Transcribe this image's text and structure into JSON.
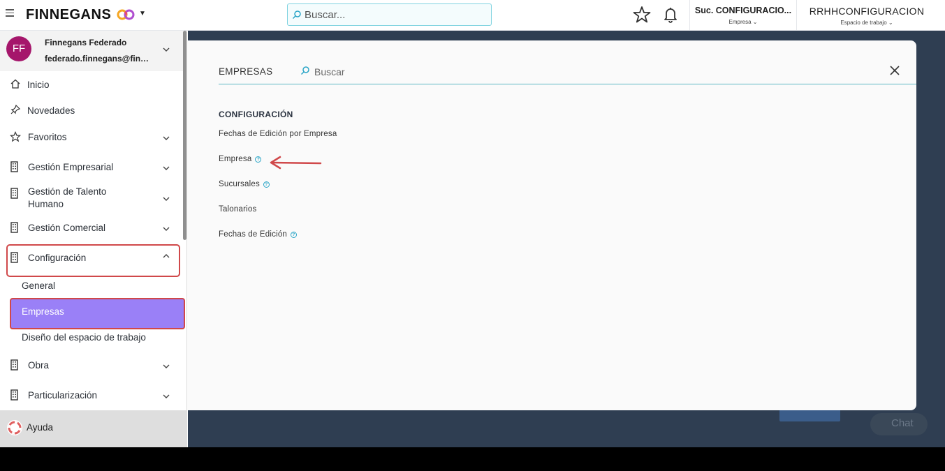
{
  "topbar": {
    "brand": "FINNEGANS",
    "search_placeholder": "Buscar...",
    "branch_value": "Suc. CONFIGURACIO...",
    "branch_label": "Empresa",
    "workspace_value": "RRHHCONFIGURACION",
    "workspace_label": "Espacio de trabajo"
  },
  "user": {
    "initials": "FF",
    "name": "Finnegans Federado",
    "email": "federado.finnegans@finnegans.com.ar"
  },
  "sidebar": {
    "items": [
      {
        "label": "Inicio",
        "icon": "home-icon"
      },
      {
        "label": "Novedades",
        "icon": "pin-icon"
      },
      {
        "label": "Favoritos",
        "icon": "star-icon"
      },
      {
        "label": "Gestión Empresarial",
        "icon": "building-icon"
      },
      {
        "label": "Gestión de Talento Humano",
        "icon": "building-icon"
      },
      {
        "label": "Gestión Comercial",
        "icon": "building-icon"
      },
      {
        "label": "Configuración",
        "icon": "building-icon"
      },
      {
        "label": "Obra",
        "icon": "building-icon"
      },
      {
        "label": "Particularización",
        "icon": "building-icon"
      }
    ],
    "config_subitems": [
      "General",
      "Empresas",
      "Diseño del espacio de trabajo"
    ],
    "help_label": "Ayuda"
  },
  "modal": {
    "title": "EMPRESAS",
    "search_placeholder": "Buscar",
    "section_title": "CONFIGURACIÓN",
    "links": [
      {
        "label": "Fechas de Edición por Empresa",
        "help": false
      },
      {
        "label": "Empresa",
        "help": true
      },
      {
        "label": "Sucursales",
        "help": true
      },
      {
        "label": "Talonarios",
        "help": false
      },
      {
        "label": "Fechas de Edición",
        "help": true
      }
    ]
  },
  "background": {
    "chat_label": "Chat"
  },
  "colors": {
    "accent_teal": "#5db6c3",
    "avatar_bg": "#a5166b",
    "selected_item": "#9a80f7",
    "highlight_border": "#d0484a",
    "backdrop": "#2f3e52"
  }
}
